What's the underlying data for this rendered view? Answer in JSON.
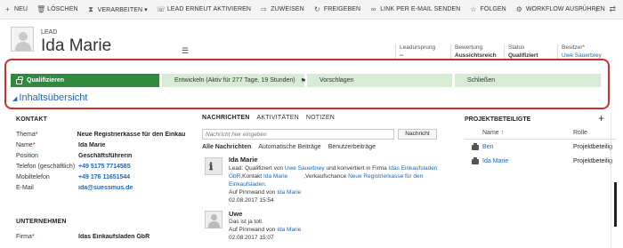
{
  "toolbar": {
    "items": [
      {
        "icon": "plus-icon",
        "label": "NEU"
      },
      {
        "icon": "trash-icon",
        "label": "LÖSCHEN"
      },
      {
        "icon": "process-icon",
        "label": "VERARBEITEN ▾"
      },
      {
        "icon": "reactivate-icon",
        "label": "LEAD ERNEUT AKTIVIEREN"
      },
      {
        "icon": "assign-icon",
        "label": "ZUWEISEN"
      },
      {
        "icon": "share-icon",
        "label": "FREIGEBEN"
      },
      {
        "icon": "link-icon",
        "label": "LINK PER E-MAIL SENDEN"
      },
      {
        "icon": "star-icon",
        "label": "FOLGEN"
      },
      {
        "icon": "workflow-icon",
        "label": "WORKFLOW AUSFÜHREN"
      }
    ],
    "nav": {
      "up": "↑",
      "down": "↓",
      "expand": "⇄"
    }
  },
  "header": {
    "entity_type": "LEAD",
    "record_name": "Ida Marie",
    "menu_glyph": "☰",
    "fields": [
      {
        "label": "Leadursprung",
        "value": "--"
      },
      {
        "label": "Bewertung",
        "value": "Aussichtsreich"
      },
      {
        "label": "Status",
        "value": "Qualifiziert"
      },
      {
        "label": "Besitzer*",
        "value": "Uwe Sauerbrey"
      }
    ]
  },
  "process": {
    "stages": [
      {
        "label": "Qualifizieren",
        "active": true
      },
      {
        "label": "Entwickeln (Aktiv für 277 Tage, 19 Stunden)",
        "active": false
      },
      {
        "label": "Vorschlagen",
        "active": false
      },
      {
        "label": "Schließen",
        "active": false
      }
    ],
    "section_title": "Inhaltsübersicht",
    "flag_glyph": "⚑"
  },
  "kontakt": {
    "title": "KONTAKT",
    "fields": [
      {
        "label": "Thema",
        "required": "*",
        "value": "Neue Registrierkasse für den Einkauf",
        "link": false
      },
      {
        "label": "Name",
        "required": "*",
        "value": "Ida Marie",
        "link": false
      },
      {
        "label": "Position",
        "required": "",
        "value": "Geschäftsführerin",
        "link": false
      },
      {
        "label": "Telefon (geschäftlich)",
        "required": "",
        "value": "+49 5175 7714585",
        "link": true
      },
      {
        "label": "Mobiltelefon",
        "required": "",
        "value": "+49 176 11651544",
        "link": true
      },
      {
        "label": "E-Mail",
        "required": "",
        "value": "ida@suessmus.de",
        "link": true
      }
    ]
  },
  "unternehmen": {
    "title": "UNTERNEHMEN",
    "firma_label": "Firma",
    "firma_required": "*",
    "firma_value": "Idas Einkaufsladen GbR"
  },
  "activity": {
    "tabs": [
      "NACHRICHTEN",
      "AKTIVITÄTEN",
      "NOTIZEN"
    ],
    "note_placeholder": "Nachricht hier eingeben",
    "note_button": "Nachricht",
    "filters": [
      "Alle Nachrichten",
      "Automatische Beiträge",
      "Benutzerbeiträge"
    ],
    "post1": {
      "author": "Ida Marie",
      "line1_a": "Lead: Qualifiziert von ",
      "line1_link1": "Uwe Sauerbrey",
      "line1_b": " und konvertiert in Firma ",
      "line1_link2": "Idas Einkaufsladen",
      "line2_link1": "GbR",
      "line2_a": ",Kontakt ",
      "line2_link2": "Ida Marie",
      "line2_b": "          ,Verkaufschance ",
      "line2_link3": "Neue Registrierkasse für den",
      "line3_link": "Einkaufsladen.",
      "wall_a": "Auf Pinnwand von ",
      "wall_link": "Ida Marie",
      "date": "02.08.2017 15:54"
    },
    "post2": {
      "author": "Uwe",
      "text": "Das ist ja toll.",
      "wall_a": "Auf Pinnwand von ",
      "wall_link": "Ida Marie",
      "date": "02.08.2017 15:07"
    }
  },
  "projektbeteiligte": {
    "title": "PROJEKTBETEILIGTE",
    "plus": "+",
    "col_name": "Name ↑",
    "col_role": "Rolle",
    "rows": [
      {
        "name": "Ben",
        "role": "Projektbeteilig"
      },
      {
        "name": "Ida Marie",
        "role": "Projektbeteilig"
      }
    ]
  }
}
